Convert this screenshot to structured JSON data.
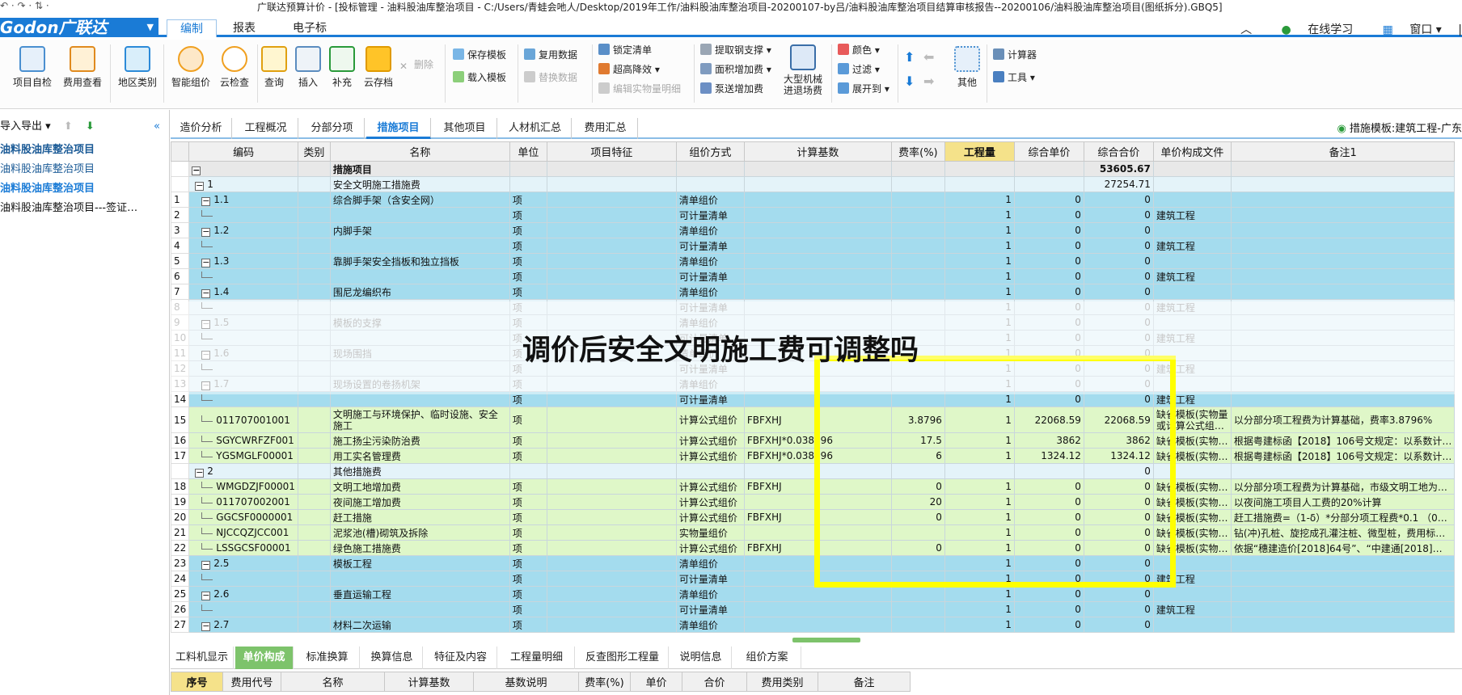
{
  "titlebar": {
    "quick_access": "↶ · ↷ · ⇅ ·",
    "title": "广联达预算计价 - [投标管理 - 油料股油库整治项目 - C:/Users/青蛙会吔人/Desktop/2019年工作/油料股油库整治项目-20200107-by吕/油料股油库整治项目结算审核报告--20200106/油料股油库整治项目(图纸拆分).GBQ5]"
  },
  "menubar": {
    "logo": "Godon广联达",
    "tabs": [
      "编制",
      "报表",
      "电子标"
    ],
    "active_tab": "编制",
    "right_items": [
      "在线学习",
      "窗口"
    ]
  },
  "ribbon": {
    "big_buttons": [
      "项目自检",
      "费用查看",
      "地区类别",
      "智能组价",
      "云检查",
      "查询",
      "插入",
      "补充",
      "云存档",
      "大型机械\n进退场费",
      "其他"
    ],
    "small_buttons": {
      "delete": "删除",
      "save_template": "保存模板",
      "load_template": "载入模板",
      "copy_data": "复用数据",
      "replace_data": "替换数据",
      "lock_list": "锁定清单",
      "lower_price": "超高降效",
      "edit_quantity": "编辑实物量明细",
      "extract_rebar": "提取钢支撑",
      "area_add": "面积增加费",
      "pump_add": "泵送增加费",
      "color": "颜色",
      "filter": "过滤",
      "expand_to": "展开到",
      "calculator": "计算器",
      "tools": "工具"
    }
  },
  "leftpane": {
    "toolbar_label": "导入导出",
    "items": [
      "油料股油库整治项目",
      "油料股油库整治项目",
      "油料股油库整治项目",
      "油料股油库整治项目---签证…"
    ]
  },
  "content_tabs": {
    "tabs": [
      "造价分析",
      "工程概况",
      "分部分项",
      "措施项目",
      "其他项目",
      "人材机汇总",
      "费用汇总"
    ],
    "active": "措施项目",
    "right_label": "措施模板:建筑工程-广东"
  },
  "grid": {
    "headers": [
      "",
      "编码",
      "类别",
      "名称",
      "单位",
      "项目特征",
      "组价方式",
      "计算基数",
      "费率(%)",
      "工程量",
      "综合单价",
      "综合合价",
      "单价构成文件",
      "备注1"
    ],
    "rows": [
      {
        "n": "",
        "code": "",
        "type": "",
        "name": "措施项目",
        "unit": "",
        "feat": "",
        "method": "",
        "base": "",
        "rate": "",
        "qty": "",
        "price": "",
        "total": "53605.67",
        "file": "",
        "note": "",
        "style": "root",
        "lvl": 0
      },
      {
        "n": "",
        "code": "1",
        "type": "",
        "name": "安全文明施工措施费",
        "unit": "",
        "feat": "",
        "method": "",
        "base": "",
        "rate": "",
        "qty": "",
        "price": "",
        "total": "27254.71",
        "file": "",
        "note": "",
        "style": "pale",
        "lvl": 1
      },
      {
        "n": "1",
        "code": "1.1",
        "type": "",
        "name": "综合脚手架（含安全网）",
        "unit": "项",
        "feat": "",
        "method": "清单组价",
        "base": "",
        "rate": "",
        "qty": "1",
        "price": "0",
        "total": "0",
        "file": "",
        "note": "",
        "style": "blue",
        "lvl": 2
      },
      {
        "n": "2",
        "code": "",
        "type": "",
        "name": "",
        "unit": "项",
        "feat": "",
        "method": "可计量清单",
        "base": "",
        "rate": "",
        "qty": "1",
        "price": "0",
        "total": "0",
        "file": "建筑工程",
        "note": "",
        "style": "blue",
        "lvl": 3
      },
      {
        "n": "3",
        "code": "1.2",
        "type": "",
        "name": "内脚手架",
        "unit": "项",
        "feat": "",
        "method": "清单组价",
        "base": "",
        "rate": "",
        "qty": "1",
        "price": "0",
        "total": "0",
        "file": "",
        "note": "",
        "style": "blue",
        "lvl": 2
      },
      {
        "n": "4",
        "code": "",
        "type": "",
        "name": "",
        "unit": "项",
        "feat": "",
        "method": "可计量清单",
        "base": "",
        "rate": "",
        "qty": "1",
        "price": "0",
        "total": "0",
        "file": "建筑工程",
        "note": "",
        "style": "blue",
        "lvl": 3
      },
      {
        "n": "5",
        "code": "1.3",
        "type": "",
        "name": "靠脚手架安全挡板和独立挡板",
        "unit": "项",
        "feat": "",
        "method": "清单组价",
        "base": "",
        "rate": "",
        "qty": "1",
        "price": "0",
        "total": "0",
        "file": "",
        "note": "",
        "style": "blue",
        "lvl": 2
      },
      {
        "n": "6",
        "code": "",
        "type": "",
        "name": "",
        "unit": "项",
        "feat": "",
        "method": "可计量清单",
        "base": "",
        "rate": "",
        "qty": "1",
        "price": "0",
        "total": "0",
        "file": "建筑工程",
        "note": "",
        "style": "blue",
        "lvl": 3
      },
      {
        "n": "7",
        "code": "1.4",
        "type": "",
        "name": "围尼龙编织布",
        "unit": "项",
        "feat": "",
        "method": "清单组价",
        "base": "",
        "rate": "",
        "qty": "1",
        "price": "0",
        "total": "0",
        "file": "",
        "note": "",
        "style": "blue",
        "lvl": 2
      },
      {
        "n": "8",
        "code": "",
        "type": "",
        "name": "",
        "unit": "项",
        "feat": "",
        "method": "可计量清单",
        "base": "",
        "rate": "",
        "qty": "1",
        "price": "0",
        "total": "0",
        "file": "建筑工程",
        "note": "",
        "style": "fade",
        "lvl": 3
      },
      {
        "n": "9",
        "code": "1.5",
        "type": "",
        "name": "模板的支撑",
        "unit": "项",
        "feat": "",
        "method": "清单组价",
        "base": "",
        "rate": "",
        "qty": "1",
        "price": "0",
        "total": "0",
        "file": "",
        "note": "",
        "style": "fade",
        "lvl": 2
      },
      {
        "n": "10",
        "code": "",
        "type": "",
        "name": "",
        "unit": "项",
        "feat": "",
        "method": "可计量清单",
        "base": "",
        "rate": "",
        "qty": "1",
        "price": "0",
        "total": "0",
        "file": "建筑工程",
        "note": "",
        "style": "fade",
        "lvl": 3
      },
      {
        "n": "11",
        "code": "1.6",
        "type": "",
        "name": "现场围挡",
        "unit": "项",
        "feat": "",
        "method": "清单组价",
        "base": "",
        "rate": "",
        "qty": "1",
        "price": "0",
        "total": "0",
        "file": "",
        "note": "",
        "style": "fade",
        "lvl": 2
      },
      {
        "n": "12",
        "code": "",
        "type": "",
        "name": "",
        "unit": "项",
        "feat": "",
        "method": "可计量清单",
        "base": "",
        "rate": "",
        "qty": "1",
        "price": "0",
        "total": "0",
        "file": "建筑工程",
        "note": "",
        "style": "fade",
        "lvl": 3
      },
      {
        "n": "13",
        "code": "1.7",
        "type": "",
        "name": "现场设置的卷扬机架",
        "unit": "项",
        "feat": "",
        "method": "清单组价",
        "base": "",
        "rate": "",
        "qty": "1",
        "price": "0",
        "total": "0",
        "file": "",
        "note": "",
        "style": "fade",
        "lvl": 2
      },
      {
        "n": "14",
        "code": "",
        "type": "",
        "name": "",
        "unit": "项",
        "feat": "",
        "method": "可计量清单",
        "base": "",
        "rate": "",
        "qty": "1",
        "price": "0",
        "total": "0",
        "file": "建筑工程",
        "note": "",
        "style": "blue",
        "lvl": 3
      },
      {
        "n": "15",
        "code": "011707001001",
        "type": "",
        "name": "文明施工与环境保护、临时设施、安全施工",
        "unit": "项",
        "feat": "",
        "method": "计算公式组价",
        "base": "FBFXHJ",
        "rate": "3.8796",
        "qty": "1",
        "price": "22068.59",
        "total": "22068.59",
        "file": "缺省模板(实物量或计算公式组…",
        "note": "以分部分项工程费为计算基础，费率3.8796%",
        "style": "green",
        "lvl": 3,
        "tall": true
      },
      {
        "n": "16",
        "code": "SGYCWRFZF001",
        "type": "",
        "name": "施工扬尘污染防治费",
        "unit": "项",
        "feat": "",
        "method": "计算公式组价",
        "base": "FBFXHJ*0.038796",
        "rate": "17.5",
        "qty": "1",
        "price": "3862",
        "total": "3862",
        "file": "缺省模板(实物…",
        "note": "根据粤建标函【2018】106号文规定：以系数计…",
        "style": "green",
        "lvl": 3
      },
      {
        "n": "17",
        "code": "YGSMGLF00001",
        "type": "",
        "name": "用工实名管理费",
        "unit": "项",
        "feat": "",
        "method": "计算公式组价",
        "base": "FBFXHJ*0.038796",
        "rate": "6",
        "qty": "1",
        "price": "1324.12",
        "total": "1324.12",
        "file": "缺省模板(实物…",
        "note": "根据粤建标函【2018】106号文规定：以系数计…",
        "style": "green",
        "lvl": 3
      },
      {
        "n": "",
        "code": "2",
        "type": "",
        "name": "其他措施费",
        "unit": "",
        "feat": "",
        "method": "",
        "base": "",
        "rate": "",
        "qty": "",
        "price": "",
        "total": "0",
        "file": "",
        "note": "",
        "style": "pale",
        "lvl": 1
      },
      {
        "n": "18",
        "code": "WMGDZJF00001",
        "type": "",
        "name": "文明工地增加费",
        "unit": "项",
        "feat": "",
        "method": "计算公式组价",
        "base": "FBFXHJ",
        "rate": "0",
        "qty": "1",
        "price": "0",
        "total": "0",
        "file": "缺省模板(实物…",
        "note": "以分部分项工程费为计算基础，市级文明工地为…",
        "style": "green",
        "lvl": 3
      },
      {
        "n": "19",
        "code": "011707002001",
        "type": "",
        "name": "夜间施工增加费",
        "unit": "项",
        "feat": "",
        "method": "计算公式组价",
        "base": "",
        "rate": "20",
        "qty": "1",
        "price": "0",
        "total": "0",
        "file": "缺省模板(实物…",
        "note": "以夜间施工项目人工费的20%计算",
        "style": "green",
        "lvl": 3
      },
      {
        "n": "20",
        "code": "GGCSF0000001",
        "type": "",
        "name": "赶工措施",
        "unit": "项",
        "feat": "",
        "method": "计算公式组价",
        "base": "FBFXHJ",
        "rate": "0",
        "qty": "1",
        "price": "0",
        "total": "0",
        "file": "缺省模板(实物…",
        "note": "赶工措施费=（1-δ）*分部分项工程费*0.1 （0…",
        "style": "green",
        "lvl": 3
      },
      {
        "n": "21",
        "code": "NJCCQZJCC001",
        "type": "",
        "name": "泥浆池(槽)砌筑及拆除",
        "unit": "项",
        "feat": "",
        "method": "实物量组价",
        "base": "",
        "rate": "",
        "qty": "1",
        "price": "0",
        "total": "0",
        "file": "缺省模板(实物…",
        "note": "钻(冲)孔桩、旋挖成孔灌注桩、微型桩，费用标…",
        "style": "green",
        "lvl": 3
      },
      {
        "n": "22",
        "code": "LSSGCSF00001",
        "type": "",
        "name": "绿色施工措施费",
        "unit": "项",
        "feat": "",
        "method": "计算公式组价",
        "base": "FBFXHJ",
        "rate": "0",
        "qty": "1",
        "price": "0",
        "total": "0",
        "file": "缺省模板(实物…",
        "note": "依据“穗建造价[2018]64号”、“中建通[2018]…",
        "style": "green",
        "lvl": 3
      },
      {
        "n": "23",
        "code": "2.5",
        "type": "",
        "name": "模板工程",
        "unit": "项",
        "feat": "",
        "method": "清单组价",
        "base": "",
        "rate": "",
        "qty": "1",
        "price": "0",
        "total": "0",
        "file": "",
        "note": "",
        "style": "blue",
        "lvl": 2
      },
      {
        "n": "24",
        "code": "",
        "type": "",
        "name": "",
        "unit": "项",
        "feat": "",
        "method": "可计量清单",
        "base": "",
        "rate": "",
        "qty": "1",
        "price": "0",
        "total": "0",
        "file": "建筑工程",
        "note": "",
        "style": "blue",
        "lvl": 3
      },
      {
        "n": "25",
        "code": "2.6",
        "type": "",
        "name": "垂直运输工程",
        "unit": "项",
        "feat": "",
        "method": "清单组价",
        "base": "",
        "rate": "",
        "qty": "1",
        "price": "0",
        "total": "0",
        "file": "",
        "note": "",
        "style": "blue",
        "lvl": 2
      },
      {
        "n": "26",
        "code": "",
        "type": "",
        "name": "",
        "unit": "项",
        "feat": "",
        "method": "可计量清单",
        "base": "",
        "rate": "",
        "qty": "1",
        "price": "0",
        "total": "0",
        "file": "建筑工程",
        "note": "",
        "style": "blue",
        "lvl": 3
      },
      {
        "n": "27",
        "code": "2.7",
        "type": "",
        "name": "材料二次运输",
        "unit": "项",
        "feat": "",
        "method": "清单组价",
        "base": "",
        "rate": "",
        "qty": "1",
        "price": "0",
        "total": "0",
        "file": "",
        "note": "",
        "style": "blue",
        "lvl": 2
      }
    ]
  },
  "overlay": {
    "title": "调价后安全文明施工费可调整吗",
    "highlight_color": "#ffff00"
  },
  "bottom": {
    "tabs": [
      "工料机显示",
      "单价构成",
      "标准换算",
      "换算信息",
      "特征及内容",
      "工程量明细",
      "反查图形工程量",
      "说明信息",
      "组价方案"
    ],
    "active": "单价构成",
    "headers": [
      "序号",
      "费用代号",
      "名称",
      "计算基数",
      "基数说明",
      "费率(%)",
      "单价",
      "合价",
      "费用类别",
      "备注"
    ]
  },
  "colors": {
    "brand": "#1a7bd6",
    "row_blue": "#a4dcee",
    "row_green": "#dff7c8",
    "active_bottom_tab": "#7dc36b"
  }
}
